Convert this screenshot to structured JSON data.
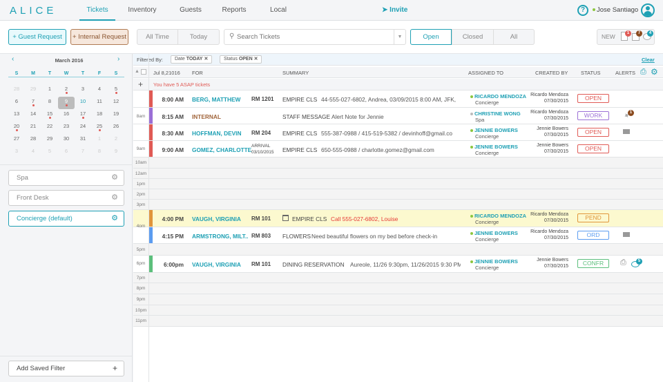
{
  "app": {
    "logo": "ALICE"
  },
  "nav": {
    "tabs": [
      "Tickets",
      "Inventory",
      "Guests",
      "Reports",
      "Local"
    ],
    "invite": "Invite",
    "user": "Jose Santiago"
  },
  "toolbar": {
    "guest_request": "+ Guest Request",
    "internal_request": "+ Internal Request",
    "time_filters": [
      "All Time",
      "Today"
    ],
    "search_placeholder": "Search Tickets",
    "status_filters": [
      "Open",
      "Closed",
      "All"
    ],
    "new_label": "NEW",
    "new_counts": {
      "documents": "1",
      "packages": "7",
      "messages": "4"
    }
  },
  "calendar": {
    "month": "March 2016",
    "weekdays": [
      "S",
      "M",
      "T",
      "W",
      "T",
      "F",
      "S"
    ],
    "weeks": [
      [
        "28",
        "29",
        "1",
        "2",
        "3",
        "4",
        "5"
      ],
      [
        "6",
        "7",
        "8",
        "9",
        "10",
        "11",
        "12"
      ],
      [
        "13",
        "14",
        "15",
        "16",
        "17",
        "18",
        "19"
      ],
      [
        "20",
        "21",
        "22",
        "23",
        "24",
        "25",
        "26"
      ],
      [
        "27",
        "28",
        "29",
        "30",
        "31",
        "1",
        "2"
      ],
      [
        "3",
        "4",
        "5",
        "6",
        "7",
        "8",
        "9"
      ]
    ],
    "selected": "9",
    "today": "10"
  },
  "saved_filters": [
    "Spa",
    "Front Desk",
    "Concierge (default)"
  ],
  "add_saved_filter": "Add Saved Filter",
  "filterbar": {
    "label": "Filtered By:",
    "chips": [
      {
        "key": "Date",
        "value": "TODAY"
      },
      {
        "key": "Status",
        "value": "OPEN"
      }
    ],
    "clear": "Clear"
  },
  "table": {
    "date": "Jul 8,21016",
    "headers": {
      "for": "FOR",
      "summary": "SUMMARY",
      "assigned": "ASSIGNED TO",
      "created": "CREATED BY",
      "status": "STATUS",
      "alerts": "ALERTS"
    },
    "asap": "You have 5 ASAP tickets",
    "hours": {
      "8am": "8am",
      "9am": "9am",
      "10am": "10am",
      "12am": "12am",
      "1pm": "1pm",
      "2pm": "2pm",
      "3pm": "3pm",
      "4pm": "4pm",
      "5pm": "5pm",
      "6pm": "6pm",
      "7pm": "7pm",
      "8pm": "8pm",
      "9pm": "9pm",
      "10pm": "10pm",
      "11pm": "11pm"
    },
    "tickets": [
      {
        "time": "8:00 AM",
        "for": "BERG, MATTHEW",
        "room": "RM 1201",
        "cat": "EMPIRE CLS",
        "summary": "44-555-027-6802, Andrea, 03/09/2015 8:00 AM, JFK,",
        "assigned": "RICARDO MENDOZA",
        "dept": "Concierge",
        "created_by": "Ricardo Mendoza",
        "created_date": "07/30/2015",
        "status": "OPEN",
        "color": "#e05a55"
      },
      {
        "time": "8:15 AM",
        "for": "INTERNAL",
        "room": "",
        "cat": "STAFF MESSAGE",
        "summary": "Alert Note for Jennie",
        "assigned": "CHRISTINE WONG",
        "dept": "Spa",
        "created_by": "Ricardo Mendoza",
        "created_date": "07/30/2015",
        "status": "WORK",
        "color": "#9b6fd6",
        "alert_count": "1"
      },
      {
        "time": "8:30 AM",
        "for": "HOFFMAN, DEVIN",
        "room": "RM 204",
        "cat": "EMPIRE CLS",
        "summary": "555-387-0988 / 415-519-5382 / devinhoff@gmail.co",
        "assigned": "JENNIE BOWERS",
        "dept": "Concierge",
        "created_by": "Jennie Bowers",
        "created_date": "07/30/2015",
        "status": "OPEN",
        "color": "#e05a55"
      },
      {
        "time": "9:00 AM",
        "for": "GOMEZ, CHARLOTTE",
        "room": "ARRIVAL",
        "room2": "03/10/2015",
        "cat": "EMPIRE CLS",
        "summary": "650-555-0988 / charlotte.gomez@gmail.com",
        "assigned": "JENNIE BOWERS",
        "dept": "Concierge",
        "created_by": "Jennie Bowers",
        "created_date": "07/30/2015",
        "status": "OPEN",
        "color": "#e05a55"
      },
      {
        "time": "4:00 PM",
        "for": "VAUGH, VIRGINIA",
        "room": "RM 101",
        "cat": "EMPIRE CLS",
        "summary": "Call 555-027-6802,  Louise",
        "assigned": "RICARDO MENDOZA",
        "dept": "Concierge",
        "created_by": "Ricardo Mendoza",
        "created_date": "07/30/2015",
        "status": "PEND",
        "color": "#e0953a"
      },
      {
        "time": "4:15 PM",
        "for": "ARMSTRONG, MILT..",
        "room": "RM 803",
        "cat": "FLOWERS",
        "summary": "Need beautiful flowers on my bed before check-in",
        "assigned": "JENNIE BOWERS",
        "dept": "Concierge",
        "created_by": "Ricardo Mendoza",
        "created_date": "07/30/2015",
        "status": "ORD",
        "color": "#5b9cf0"
      },
      {
        "time": "6:00pm",
        "for": "VAUGH, VIRGINIA",
        "room": "RM 101",
        "cat": "DINING RESERVATION",
        "summary": "Aureole, 11/26 9:30pm, 11/26/2015 9:30 PM",
        "assigned": "JENNIE BOWERS",
        "dept": "Concierge",
        "created_by": "Jennie Bowers",
        "created_date": "07/30/2015",
        "status": "CONFR",
        "color": "#5cbf7c",
        "alert_count": "5"
      }
    ]
  },
  "status_colors": {
    "OPEN": "#e05a55",
    "WORK": "#9b6fd6",
    "PEND": "#e0953a",
    "ORD": "#5b9cf0",
    "CONFR": "#5cbf7c"
  },
  "accent": "#1ea0b4"
}
